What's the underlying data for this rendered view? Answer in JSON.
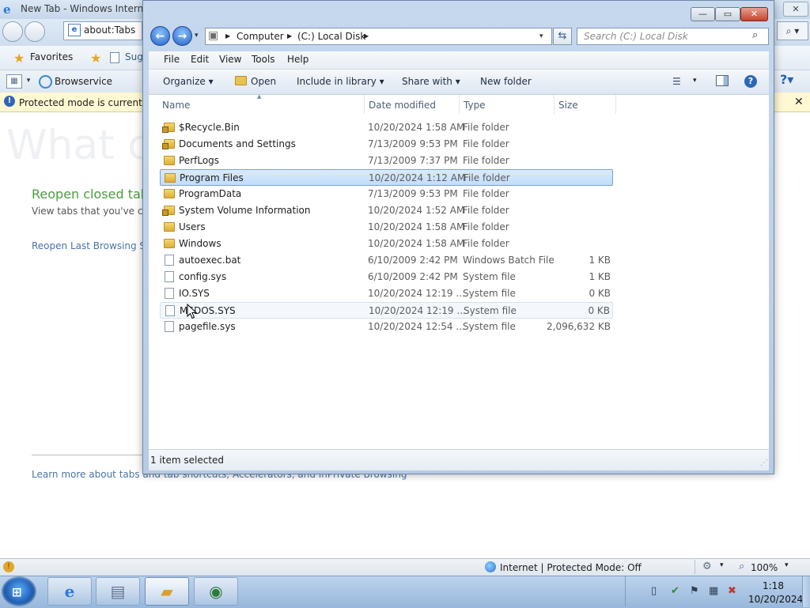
{
  "ie": {
    "title": "New Tab - Windows Internet",
    "address": "about:Tabs",
    "favorites_label": "Favorites",
    "suggested_label": "Sug",
    "tab_label": "Browservice",
    "infobar_text": "Protected mode is currently tu",
    "heading": "What c",
    "reopen_closed": "Reopen closed tab",
    "view_tabs": "View tabs that you've clo",
    "reopen_last": "Reopen Last Browsing S",
    "learn_more": "Learn more about tabs and tab shortcuts, Accelerators, and InPrivate Browsing",
    "status_zone": "Internet | Protected Mode: Off",
    "zoom": "100%"
  },
  "explorer": {
    "breadcrumbs": [
      "Computer",
      "(C:) Local Disk"
    ],
    "search_placeholder": "Search (C:) Local Disk",
    "menu": {
      "file": "File",
      "edit": "Edit",
      "view": "View",
      "tools": "Tools",
      "help": "Help"
    },
    "commands": {
      "organize": "Organize",
      "open": "Open",
      "include": "Include in library",
      "share": "Share with",
      "new_folder": "New folder"
    },
    "columns": {
      "name": "Name",
      "date": "Date modified",
      "type": "Type",
      "size": "Size"
    },
    "rows": [
      {
        "name": "$Recycle.Bin",
        "date": "10/20/2024 1:58 AM",
        "type": "File folder",
        "size": "",
        "icon": "locked-folder-icon"
      },
      {
        "name": "Documents and Settings",
        "date": "7/13/2009 9:53 PM",
        "type": "File folder",
        "size": "",
        "icon": "locked-folder-icon"
      },
      {
        "name": "PerfLogs",
        "date": "7/13/2009 7:37 PM",
        "type": "File folder",
        "size": "",
        "icon": "folder-icon"
      },
      {
        "name": "Program Files",
        "date": "10/20/2024 1:12 AM",
        "type": "File folder",
        "size": "",
        "icon": "folder-icon"
      },
      {
        "name": "ProgramData",
        "date": "7/13/2009 9:53 PM",
        "type": "File folder",
        "size": "",
        "icon": "folder-icon"
      },
      {
        "name": "System Volume Information",
        "date": "10/20/2024 1:52 AM",
        "type": "File folder",
        "size": "",
        "icon": "locked-folder-icon"
      },
      {
        "name": "Users",
        "date": "10/20/2024 1:58 AM",
        "type": "File folder",
        "size": "",
        "icon": "folder-icon"
      },
      {
        "name": "Windows",
        "date": "10/20/2024 1:58 AM",
        "type": "File folder",
        "size": "",
        "icon": "folder-icon"
      },
      {
        "name": "autoexec.bat",
        "date": "6/10/2009 2:42 PM",
        "type": "Windows Batch File",
        "size": "1 KB",
        "icon": "file-icon"
      },
      {
        "name": "config.sys",
        "date": "6/10/2009 2:42 PM",
        "type": "System file",
        "size": "1 KB",
        "icon": "file-icon"
      },
      {
        "name": "IO.SYS",
        "date": "10/20/2024 12:19 ...",
        "type": "System file",
        "size": "0 KB",
        "icon": "file-icon"
      },
      {
        "name": "MSDOS.SYS",
        "date": "10/20/2024 12:19 ...",
        "type": "System file",
        "size": "0 KB",
        "icon": "file-icon"
      },
      {
        "name": "pagefile.sys",
        "date": "10/20/2024 12:54 ...",
        "type": "System file",
        "size": "2,096,632 KB",
        "icon": "file-icon"
      }
    ],
    "selected_row": "Program Files",
    "status_text": "1 item selected"
  },
  "taskbar": {
    "time": "1:18",
    "date": "10/20/2024"
  }
}
